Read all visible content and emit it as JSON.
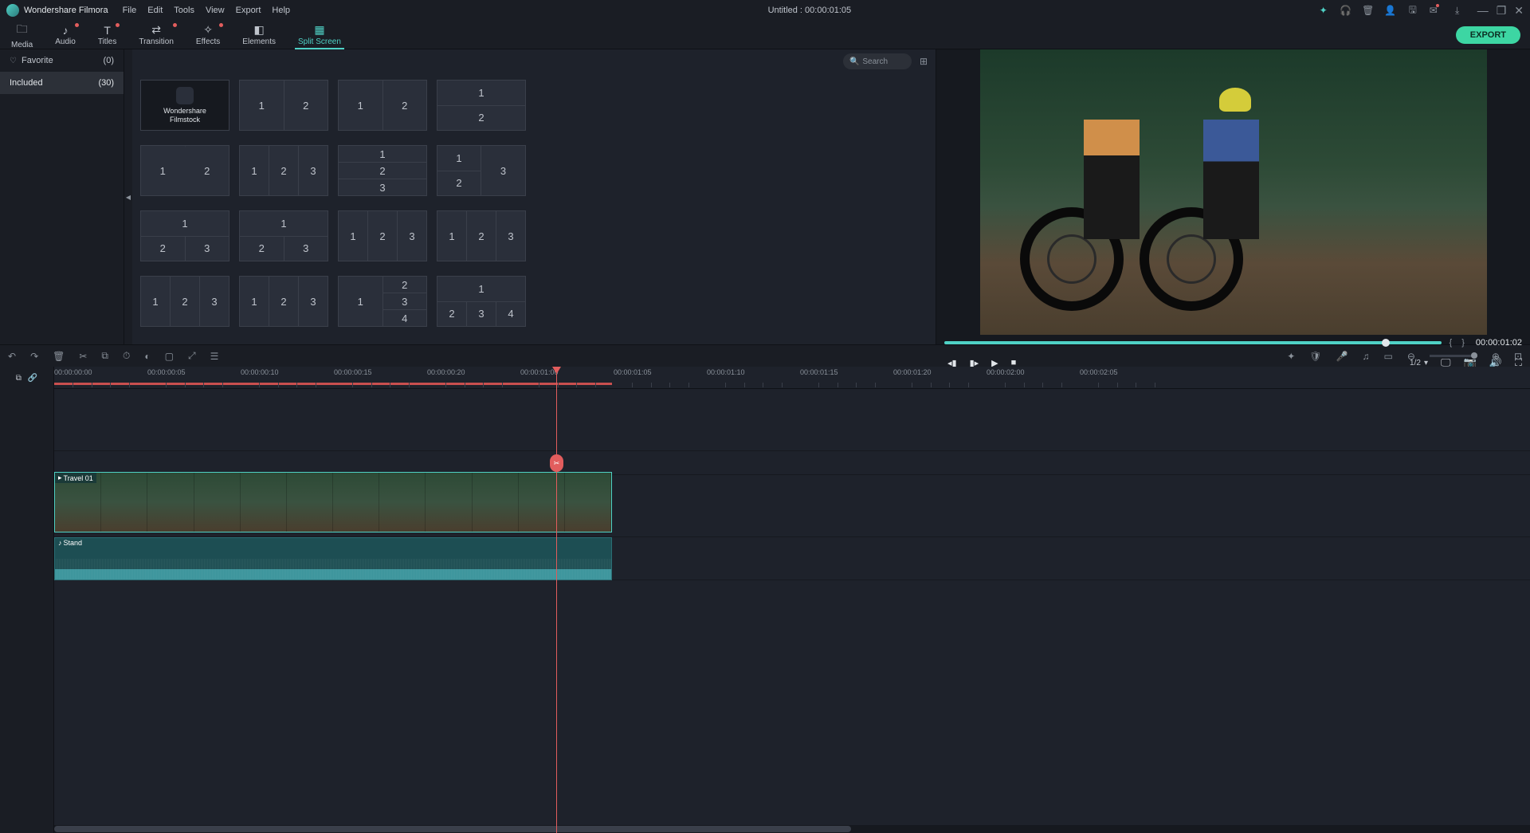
{
  "titlebar": {
    "app_name": "Wondershare Filmora",
    "menus": [
      "File",
      "Edit",
      "Tools",
      "View",
      "Export",
      "Help"
    ],
    "document_title": "Untitled : 00:00:01:05"
  },
  "toolbar": {
    "tabs": [
      {
        "label": "Media",
        "icon": "folder-icon"
      },
      {
        "label": "Audio",
        "icon": "music-icon",
        "dot": true
      },
      {
        "label": "Titles",
        "icon": "text-icon",
        "dot": true
      },
      {
        "label": "Transition",
        "icon": "transition-icon",
        "dot": true
      },
      {
        "label": "Effects",
        "icon": "sparkle-icon",
        "dot": true
      },
      {
        "label": "Elements",
        "icon": "shapes-icon"
      },
      {
        "label": "Split Screen",
        "icon": "grid-icon",
        "active": true
      }
    ],
    "export_label": "EXPORT"
  },
  "sidebar": {
    "items": [
      {
        "label": "Favorite",
        "count": "(0)",
        "icon": "heart"
      },
      {
        "label": "Included",
        "count": "(30)",
        "active": true
      }
    ]
  },
  "browser": {
    "search_placeholder": "Search",
    "filmstock_label": "Wondershare Filmstock"
  },
  "preview": {
    "timecode": "00:00:01:02",
    "ratio": "1/2"
  },
  "timeline": {
    "ruler_ticks": [
      "00:00:00:00",
      "00:00:00:05",
      "00:00:00:10",
      "00:00:00:15",
      "00:00:00:20",
      "00:00:01:00",
      "00:00:01:05",
      "00:00:01:10",
      "00:00:01:15",
      "00:00:01:20",
      "00:00:02:00",
      "00:00:02:05"
    ],
    "tracks": {
      "video2": "2",
      "video1": "1",
      "audio1": "1"
    },
    "clips": {
      "video": {
        "label": "Travel 01"
      },
      "audio": {
        "label": "Stand"
      }
    }
  }
}
